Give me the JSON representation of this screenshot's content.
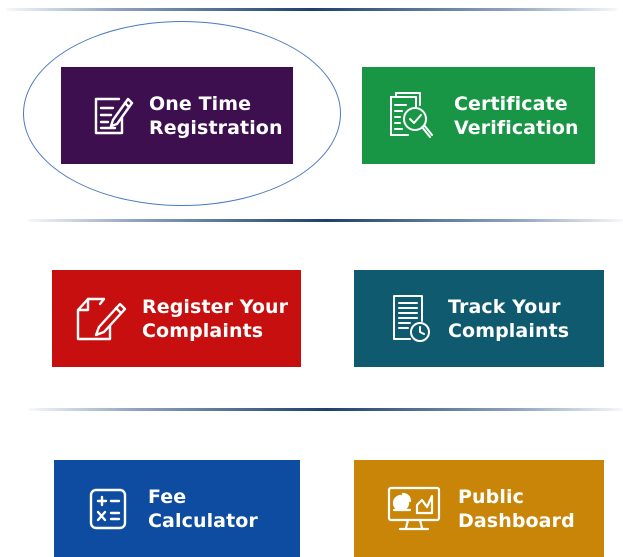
{
  "tiles": {
    "one_time_registration": {
      "line1": "One Time",
      "line2": "Registration",
      "icon": "edit-document-icon",
      "color": "#3d0f4e"
    },
    "certificate_verification": {
      "line1": "Certificate",
      "line2": "Verification",
      "icon": "certificate-search-icon",
      "color": "#189646"
    },
    "register_complaints": {
      "line1": "Register Your",
      "line2": "Complaints",
      "icon": "pen-paper-icon",
      "color": "#c80f0f"
    },
    "track_complaints": {
      "line1": "Track Your",
      "line2": "Complaints",
      "icon": "document-clock-icon",
      "color": "#0f5a6e"
    },
    "fee_calculator": {
      "line1": "Fee",
      "line2": "Calculator",
      "icon": "calculator-icon",
      "color": "#0d4ca0"
    },
    "public_dashboard": {
      "line1": "Public",
      "line2": "Dashboard",
      "icon": "dashboard-monitor-icon",
      "color": "#c98508"
    }
  },
  "highlight": {
    "color": "#4a7bbf"
  }
}
